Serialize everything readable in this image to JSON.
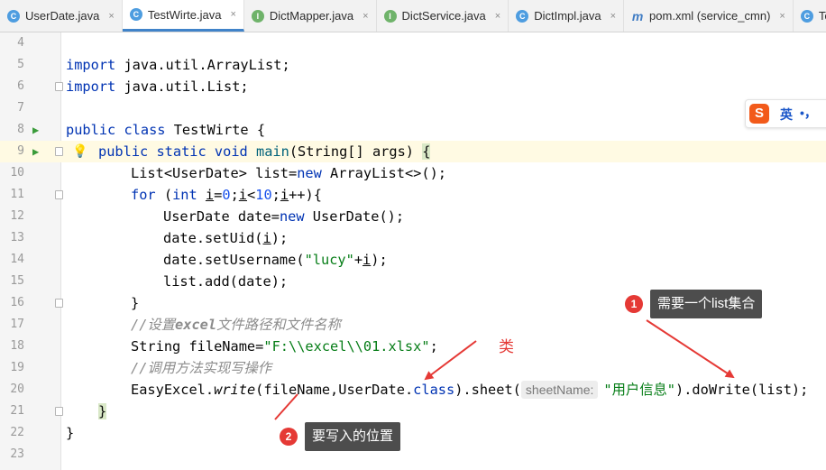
{
  "tabs": [
    {
      "label": "UserDate.java",
      "icon": "class-icon",
      "active": false
    },
    {
      "label": "TestWirte.java",
      "icon": "run-class-icon",
      "active": true
    },
    {
      "label": "DictMapper.java",
      "icon": "interface-icon",
      "active": false
    },
    {
      "label": "DictService.java",
      "icon": "interface-icon",
      "active": false
    },
    {
      "label": "DictImpl.java",
      "icon": "class-icon",
      "active": false
    },
    {
      "label": "pom.xml (service_cmn)",
      "icon": "maven-icon",
      "active": false
    },
    {
      "label": "TestRead",
      "icon": "run-class-icon",
      "active": false
    }
  ],
  "tab_close_glyph": "×",
  "editor": {
    "current_line": 9,
    "line_numbers": [
      "4",
      "5",
      "6",
      "7",
      "8",
      "9",
      "10",
      "11",
      "12",
      "13",
      "14",
      "15",
      "16",
      "17",
      "18",
      "19",
      "20",
      "21",
      "22",
      "23"
    ],
    "code": {
      "l5": {
        "kw": "import",
        "rest": " java.util.ArrayList;"
      },
      "l6": {
        "kw": "import",
        "rest": " java.util.List;"
      },
      "l8": {
        "kw": "public class",
        "rest": " TestWirte {"
      },
      "l9": {
        "kw": "public static void",
        "name": " main",
        "rest": "(String[] args) ",
        "brace": "{"
      },
      "l10": {
        "a": "List<UserDate> list=",
        "kw": "new",
        "b": " ArrayList<>();"
      },
      "l11": {
        "kw": "for",
        "a": " (",
        "kw2": "int",
        "b": " ",
        "i1": "i",
        "c": "=",
        "n1": "0",
        "d": ";",
        "i2": "i",
        "e": "<",
        "n2": "10",
        "f": ";",
        "i3": "i",
        "g": "++){"
      },
      "l12": {
        "a": "UserDate date=",
        "kw": "new",
        "b": " UserDate();"
      },
      "l13": {
        "a": "date.setUid(",
        "i": "i",
        "b": ");"
      },
      "l14": {
        "a": "date.setUsername(",
        "s": "\"lucy\"",
        "b": "+",
        "i": "i",
        "c": ");"
      },
      "l15": {
        "a": "list.add(date);"
      },
      "l16": {
        "a": "}"
      },
      "l17": {
        "c1": "//设置",
        "c2": "excel",
        "c3": "文件路径和文件名称"
      },
      "l18": {
        "a": "String fileName=",
        "s": "\"F:\\\\excel\\\\01.xlsx\"",
        "b": ";"
      },
      "l19": {
        "c1": "//调用方法实现写操作"
      },
      "l20": {
        "a": "EasyExcel.",
        "m": "write",
        "b": "(fileName,UserDate.",
        "kw": "class",
        "c": ").sheet(",
        "hint": "sheetName:",
        "s": "\"用户信息\"",
        "d": ").doWrite(list);"
      },
      "l21": {
        "a": "}"
      },
      "l22": {
        "a": "}"
      }
    }
  },
  "annotations": {
    "callout1": {
      "num": "1",
      "text": "需要一个list集合"
    },
    "callout2": {
      "num": "2",
      "text": "要写入的位置"
    },
    "class_label": "类"
  },
  "ime": {
    "logo": "S",
    "mode": "英",
    "punc": "•，"
  },
  "colors": {
    "accent": "#4083c9",
    "annotation_red": "#e53935",
    "callout_bg": "#4d4d4d",
    "keyword": "#0033b3",
    "string": "#067d17",
    "comment": "#8c8c8c"
  }
}
